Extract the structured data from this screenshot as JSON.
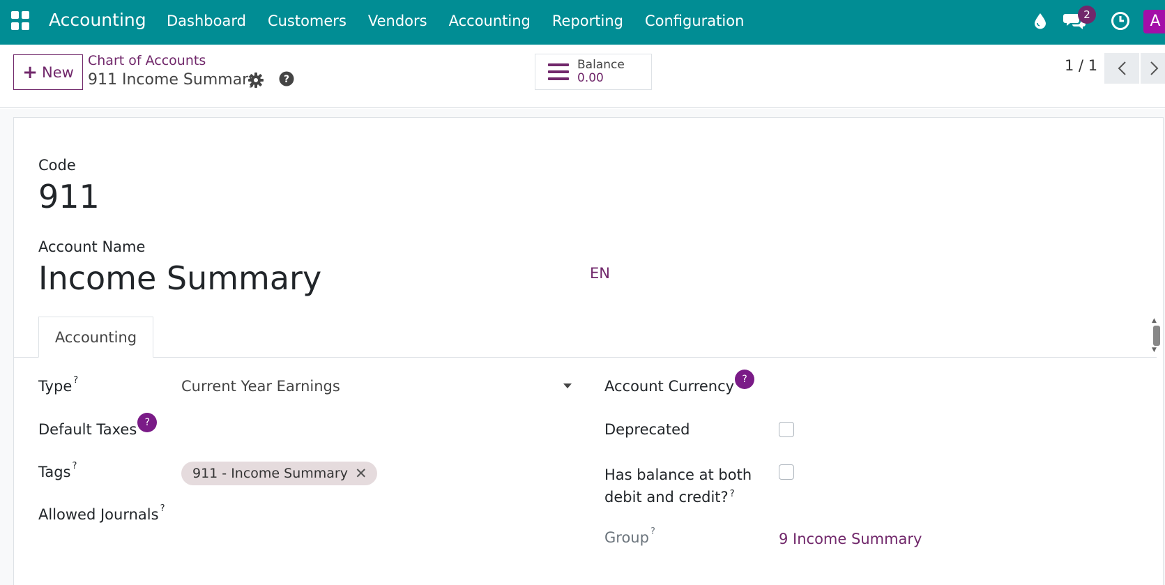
{
  "navbar": {
    "app_title": "Accounting",
    "menu": [
      "Dashboard",
      "Customers",
      "Vendors",
      "Accounting",
      "Reporting",
      "Configuration"
    ],
    "chat_badge": "2",
    "avatar_letter": "A",
    "icons": [
      "apps-grid-icon",
      "drop-icon",
      "chat-icon",
      "clock-icon"
    ]
  },
  "control": {
    "new_label": "New",
    "breadcrumb": "Chart of Accounts",
    "record_title": "911 Income Summary",
    "smart_button": {
      "label": "Balance",
      "value": "0.00"
    },
    "pager": "1 / 1"
  },
  "form": {
    "code_label": "Code",
    "code_value": "911",
    "name_label": "Account Name",
    "name_value": "Income Summary",
    "lang": "EN",
    "tab": "Accounting",
    "left": {
      "type_label": "Type",
      "type_value": "Current Year Earnings",
      "default_taxes_label": "Default Taxes",
      "tags_label": "Tags",
      "tag_value": "911 - Income Summary",
      "allowed_journals_label": "Allowed Journals"
    },
    "right": {
      "account_currency_label": "Account Currency",
      "deprecated_label": "Deprecated",
      "both_balance_label_line1": "Has balance at both",
      "both_balance_label_line2": "debit and credit?",
      "group_label": "Group",
      "group_value": "9 Income Summary"
    },
    "help_mark": "?",
    "tooltip_mark": "?",
    "tag_remove": "✕"
  },
  "colors": {
    "navbar": "#018d94",
    "primary": "#71286b",
    "help_bubble": "#7a1b87",
    "avatar": "#a30ea8"
  }
}
